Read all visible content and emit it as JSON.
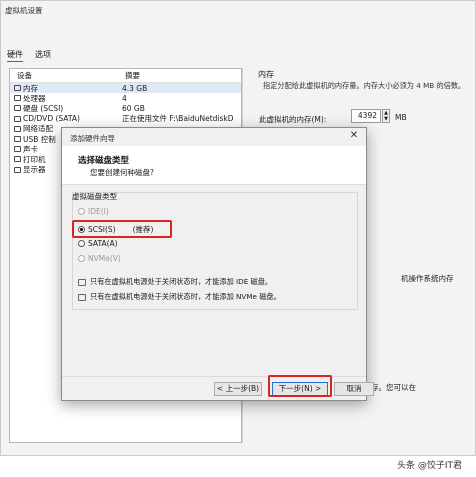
{
  "background_window": {
    "title": "虚拟机设置",
    "tabs": [
      "硬件",
      "选项"
    ],
    "list_headers": [
      "设备",
      "摘要"
    ],
    "devices": [
      {
        "name": "内存",
        "summary": "4.3 GB",
        "icon": "memory-icon"
      },
      {
        "name": "处理器",
        "summary": "4",
        "icon": "cpu-icon"
      },
      {
        "name": "硬盘 (SCSI)",
        "summary": "60 GB",
        "icon": "harddisk-icon"
      },
      {
        "name": "CD/DVD (SATA)",
        "summary": "正在使用文件 F:\\BaiduNetdiskD",
        "icon": "cdrom-icon"
      },
      {
        "name": "网络适配",
        "summary": "",
        "icon": "network-icon"
      },
      {
        "name": "USB 控制",
        "summary": "",
        "icon": "usb-icon"
      },
      {
        "name": "声卡",
        "summary": "",
        "icon": "sound-icon"
      },
      {
        "name": "打印机",
        "summary": "",
        "icon": "printer-icon"
      },
      {
        "name": "显示器",
        "summary": "",
        "icon": "display-icon"
      }
    ],
    "memory_section": {
      "title": "内存",
      "description": "指定分配给此虚拟机的内存量。内存大小必须为 4 MB 的倍数。",
      "label": "此虚拟机的内存(M):",
      "value": "4392",
      "unit": "MB"
    },
    "peek_text_1": "机操作系统内存",
    "peek_text_2": "存。您可以在"
  },
  "dialog": {
    "title": "添加硬件向导",
    "close_glyph": "✕",
    "header_title": "选择磁盘类型",
    "header_subtitle": "您要创建何种磁盘?",
    "group_label": "虚拟磁盘类型",
    "options": [
      {
        "label": "IDE(I)",
        "checked": false,
        "disabled": true
      },
      {
        "label": "SCSI(S)",
        "checked": true,
        "disabled": false,
        "note": "(推荐)"
      },
      {
        "label": "SATA(A)",
        "checked": false,
        "disabled": false
      },
      {
        "label": "NVMe(V)",
        "checked": false,
        "disabled": true
      }
    ],
    "info_lines": [
      "只有在虚拟机电源处于关闭状态时，才能添加 IDE 磁盘。",
      "只有在虚拟机电源处于关闭状态时，才能添加 NVMe 磁盘。"
    ],
    "buttons": {
      "back": "< 上一步(B)",
      "next": "下一步(N) >",
      "cancel": "取消"
    },
    "highlight_color": "#dd2222"
  },
  "watermark": "头条 @饺子IT君"
}
